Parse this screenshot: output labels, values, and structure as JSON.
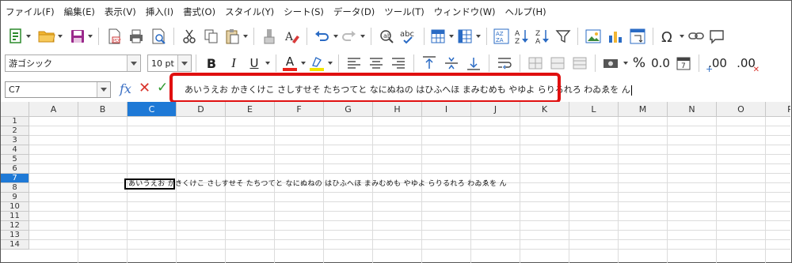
{
  "menu": [
    "ファイル(F)",
    "編集(E)",
    "表示(V)",
    "挿入(I)",
    "書式(O)",
    "スタイル(Y)",
    "シート(S)",
    "データ(D)",
    "ツール(T)",
    "ウィンドウ(W)",
    "ヘルプ(H)"
  ],
  "format_toolbar": {
    "font_name": "游ゴシック",
    "font_size": "10 pt",
    "bold": "B",
    "italic": "I",
    "underline": "U",
    "font_color_letter": "A",
    "percent": "%",
    "number_format": "0.0",
    "add_decimal": ".00",
    "remove_decimal": ".00"
  },
  "formula_bar": {
    "name_box": "C7",
    "fx": "fx",
    "cancel": "✕",
    "accept": "✓",
    "content": "あいうえお かきくけこ さしすせそ たちつてと なにぬねの はひふへほ まみむめも やゆよ らりるれろ わゐゑを ん"
  },
  "sheet": {
    "columns": [
      "A",
      "B",
      "C",
      "D",
      "E",
      "F",
      "G",
      "H",
      "I",
      "J",
      "K",
      "L",
      "M",
      "N",
      "O",
      "P"
    ],
    "rows": [
      "1",
      "2",
      "3",
      "4",
      "5",
      "6",
      "7",
      "8",
      "9",
      "10",
      "11",
      "12",
      "13",
      "14"
    ],
    "active_column": "C",
    "active_row": "7",
    "cell_c7": "あいうえお かきくけこ さしすせそ たちつてと なにぬねの はひふへほ まみむめも やゆよ らりるれろ わゐゑを ん"
  },
  "colors": {
    "highlight_border": "#e01010",
    "header_active": "#1e79d6",
    "font_color_bar": "#e8231b",
    "highlight_color_bar": "#f2e500"
  }
}
